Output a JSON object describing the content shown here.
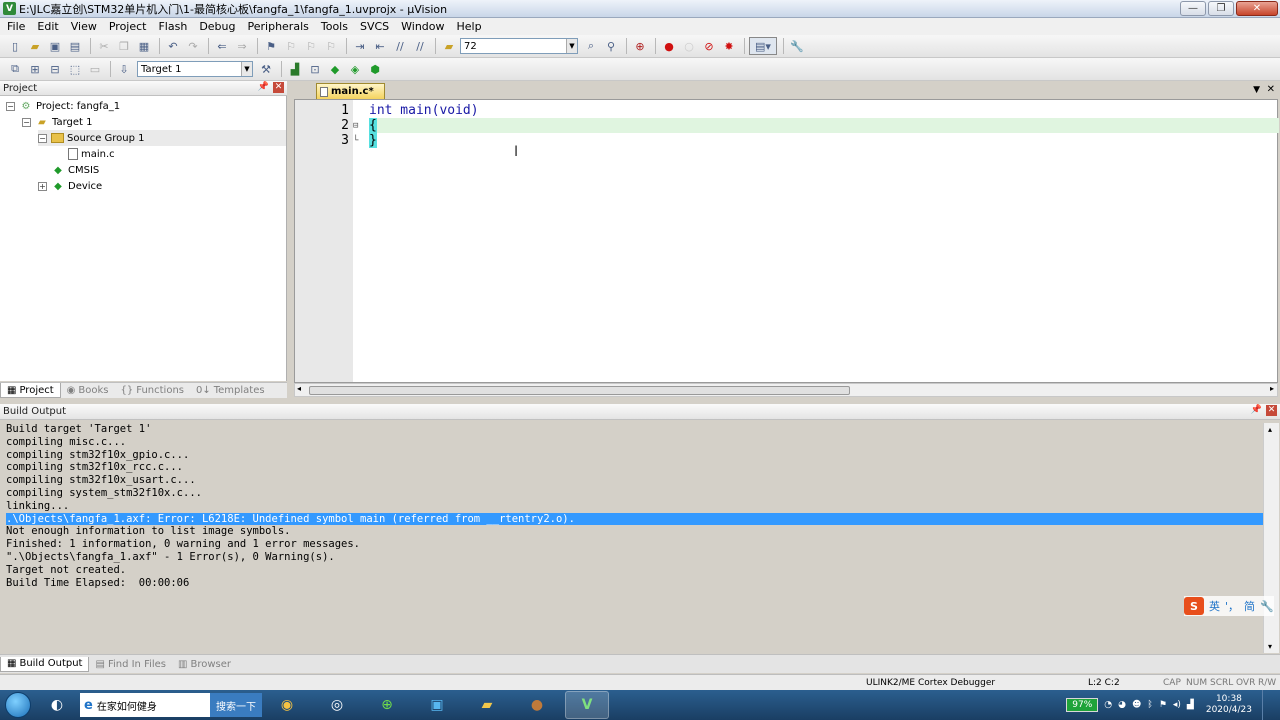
{
  "window": {
    "title": "E:\\JLC嘉立创\\STM32单片机入门\\1-最简核心板\\fangfa_1\\fangfa_1.uvprojx - µVision",
    "app_icon": "V",
    "min": "—",
    "max": "❐",
    "close": "✕"
  },
  "menubar": {
    "items": [
      "File",
      "Edit",
      "View",
      "Project",
      "Flash",
      "Debug",
      "Peripherals",
      "Tools",
      "SVCS",
      "Window",
      "Help"
    ]
  },
  "toolbar": {
    "find_combo_value": "72",
    "target_combo_value": "Target 1"
  },
  "project_pane": {
    "title": "Project",
    "pin": "📌",
    "close": "✕",
    "tree": {
      "project": "Project: fangfa_1",
      "target": "Target 1",
      "group": "Source Group 1",
      "file": "main.c",
      "cmsis": "CMSIS",
      "device": "Device"
    },
    "tabs": [
      "Project",
      "Books",
      "Functions",
      "Templates"
    ]
  },
  "editor": {
    "tab_label": "main.c*",
    "lines": [
      {
        "num": "1",
        "code": "int main(void)"
      },
      {
        "num": "2",
        "code": "{"
      },
      {
        "num": "3",
        "code": "}"
      }
    ]
  },
  "build_output": {
    "title": "Build Output",
    "lines": [
      "Build target 'Target 1'",
      "compiling misc.c...",
      "compiling stm32f10x_gpio.c...",
      "compiling stm32f10x_rcc.c...",
      "compiling stm32f10x_usart.c...",
      "compiling system_stm32f10x.c...",
      "linking...",
      ".\\Objects\\fangfa_1.axf: Error: L6218E: Undefined symbol main (referred from __rtentry2.o).",
      "Not enough information to list image symbols.",
      "Finished: 1 information, 0 warning and 1 error messages.",
      "\".\\Objects\\fangfa_1.axf\" - 1 Error(s), 0 Warning(s).",
      "Target not created.",
      "Build Time Elapsed:  00:00:06"
    ],
    "error_line_index": 7,
    "tabs": [
      "Build Output",
      "Find In Files",
      "Browser"
    ]
  },
  "statusbar": {
    "debugger": "ULINK2/ME Cortex Debugger",
    "position": "L:2 C:2",
    "indicators": [
      "CAP",
      "NUM",
      "SCRL",
      "OVR",
      "R/W"
    ]
  },
  "ime": {
    "logo": "S",
    "lang": "英",
    "punct": "'，",
    "mode": "简"
  },
  "taskbar": {
    "search_text": "在家如何健身",
    "search_button": "搜索一下",
    "battery": "97%",
    "time": "10:38",
    "date": "2020/4/23"
  },
  "colors": {
    "selection_blue": "#3399ff",
    "current_line": "#e0f5e0",
    "brace_highlight": "#57e0e0",
    "keyword": "#1a1aa6"
  }
}
